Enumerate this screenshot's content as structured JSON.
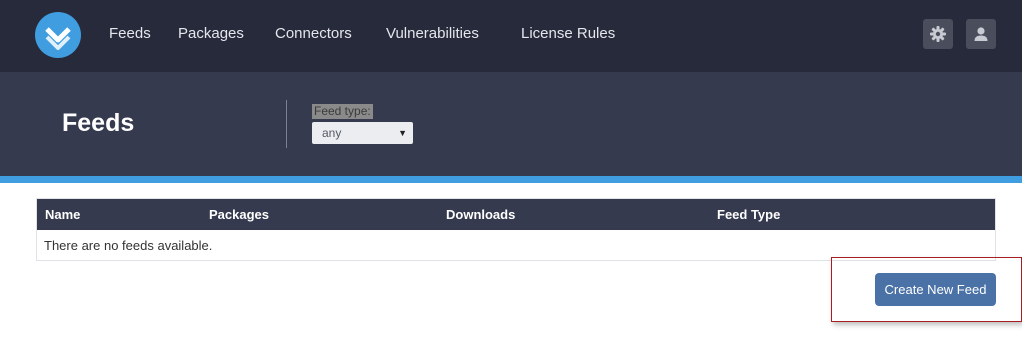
{
  "nav": {
    "logo": "proget-logo-icon",
    "links": [
      "Feeds",
      "Packages",
      "Connectors",
      "Vulnerabilities",
      "License Rules"
    ],
    "settings_icon": "gear-icon",
    "user_icon": "user-icon"
  },
  "header": {
    "title": "Feeds",
    "filter_label": "Feed type:",
    "filter_value": "any"
  },
  "table": {
    "columns": [
      "Name",
      "Packages",
      "Downloads",
      "Feed Type"
    ],
    "empty_message": "There are no feeds available."
  },
  "actions": {
    "create_feed_label": "Create New Feed"
  },
  "colors": {
    "nav_bg": "#262a3b",
    "header_bg": "#363a4e",
    "accent": "#3f9de0",
    "button": "#4a72a6",
    "highlight": "#a81d24"
  }
}
